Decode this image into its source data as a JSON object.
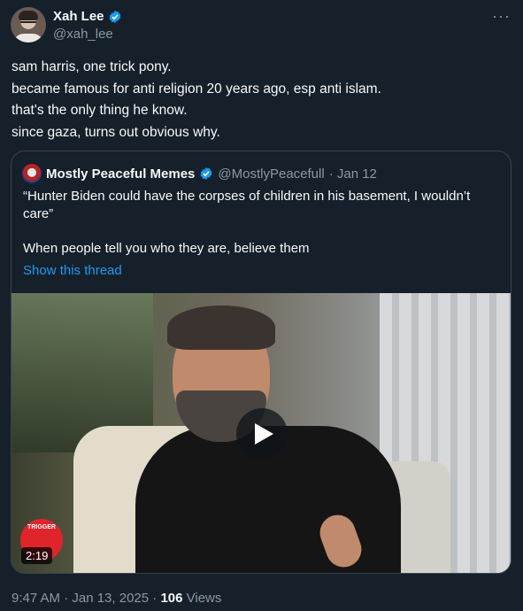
{
  "author": {
    "name": "Xah Lee",
    "handle": "@xah_lee",
    "more_label": "···"
  },
  "post": {
    "lines": [
      "sam harris, one trick pony.",
      "became famous for anti religion 20 years ago, esp anti islam.",
      "that's the only thing he know.",
      "since gaza, turns out obvious why."
    ]
  },
  "quote": {
    "name": "Mostly Peaceful Memes",
    "handle": "@MostlyPeacefull",
    "date": "· Jan 12",
    "body": "“Hunter Biden could have the corpses of children in his basement, I wouldn’t care”",
    "line2": "When people tell you who they are, believe them",
    "thread_link": "Show this thread",
    "video": {
      "duration": "2:19",
      "trigger_badge": "TRIGGER"
    }
  },
  "footer": {
    "time_date": "9:47 AM · Jan 13, 2025 · ",
    "views_count": "106",
    "views_label": " Views"
  },
  "colors": {
    "background": "#15202b",
    "accent": "#1d9bf0",
    "muted": "#8b98a5",
    "border": "#38444d"
  }
}
